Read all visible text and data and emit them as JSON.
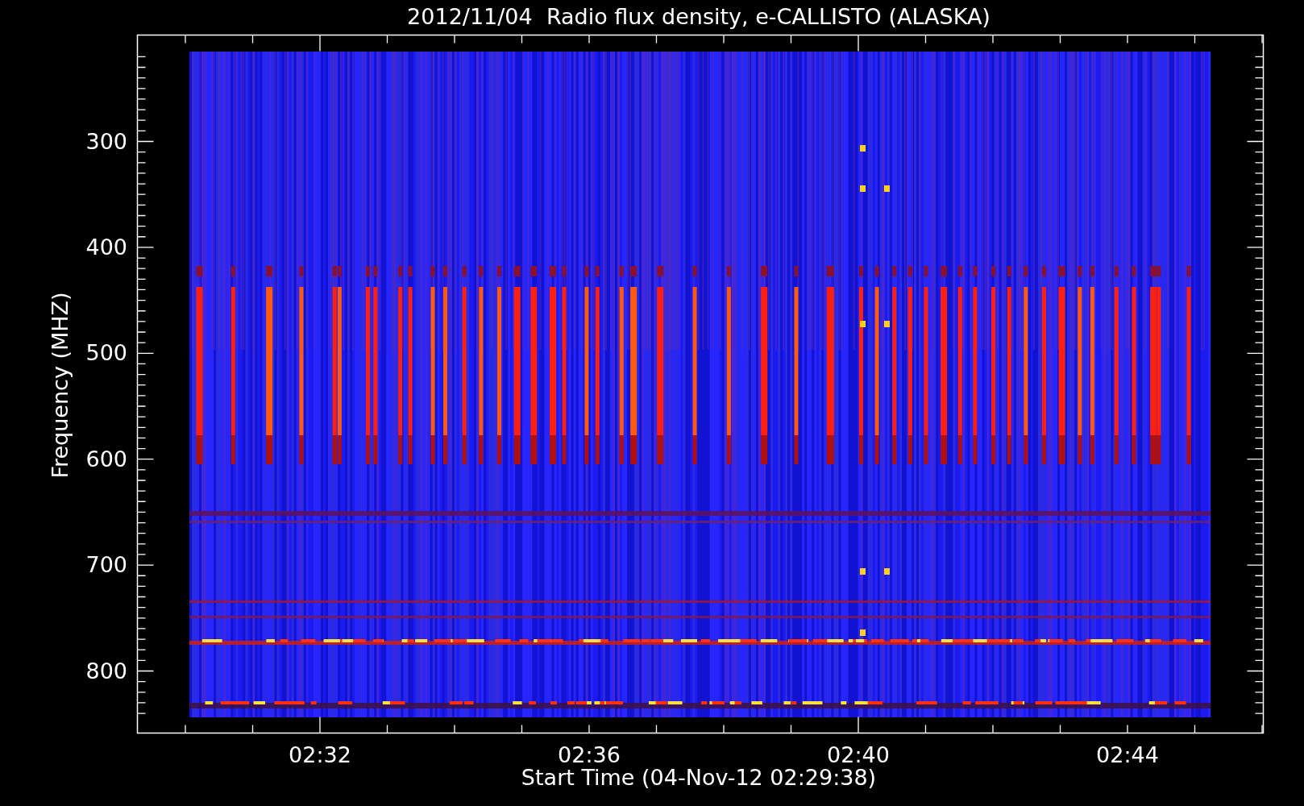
{
  "title": "2012/11/04  Radio flux density, e-CALLISTO (ALASKA)",
  "y_axis": {
    "label": "Frequency (MHZ)",
    "ticks": [
      "300",
      "400",
      "500",
      "600",
      "700",
      "800"
    ]
  },
  "x_axis": {
    "label": "Start Time (04-Nov-12 02:29:38)",
    "ticks": [
      "02:32",
      "02:36",
      "02:40",
      "02:44"
    ]
  }
}
